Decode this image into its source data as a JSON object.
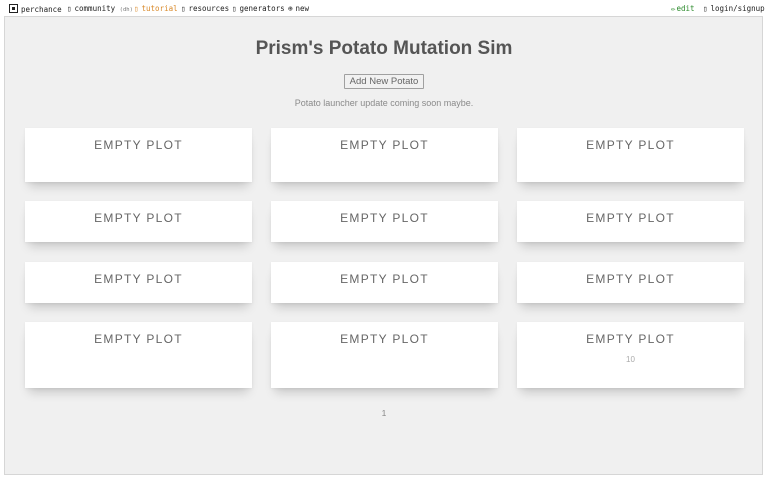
{
  "nav": {
    "home": "perchance",
    "community": "community",
    "community_badge": "(dh)",
    "tutorial": "tutorial",
    "resources": "resources",
    "generators": "generators",
    "new": "new",
    "edit": "edit",
    "login": "login/signup",
    "tutorial_color": "#d98a2b",
    "edit_color": "#2b8a2b"
  },
  "page": {
    "title": "Prism's Potato Mutation Sim",
    "add_button": "Add New Potato",
    "subtitle": "Potato launcher update coming soon maybe.",
    "page_number": "1"
  },
  "plots": [
    {
      "label": "EMPTY PLOT",
      "count": ""
    },
    {
      "label": "EMPTY PLOT",
      "count": ""
    },
    {
      "label": "EMPTY PLOT",
      "count": ""
    },
    {
      "label": "EMPTY PLOT",
      "count": ""
    },
    {
      "label": "EMPTY PLOT",
      "count": ""
    },
    {
      "label": "EMPTY PLOT",
      "count": ""
    },
    {
      "label": "EMPTY PLOT",
      "count": ""
    },
    {
      "label": "EMPTY PLOT",
      "count": ""
    },
    {
      "label": "EMPTY PLOT",
      "count": ""
    },
    {
      "label": "EMPTY PLOT",
      "count": ""
    },
    {
      "label": "EMPTY PLOT",
      "count": ""
    },
    {
      "label": "EMPTY PLOT",
      "count": "10"
    }
  ]
}
